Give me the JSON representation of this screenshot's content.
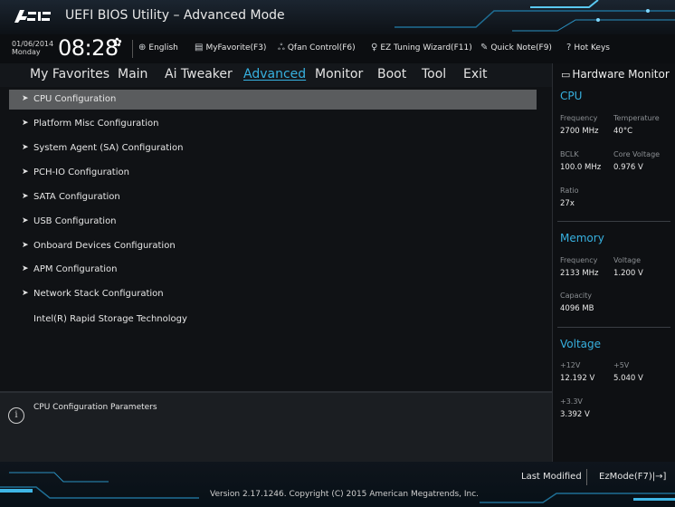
{
  "window": {
    "logo_text": "ASUS",
    "title": "UEFI BIOS Utility – Advanced Mode"
  },
  "infobar": {
    "date": "01/06/2014",
    "day": "Monday",
    "time": "08:28",
    "settings_icon": "gear-icon",
    "tools": [
      {
        "icon": "globe-icon",
        "label": "English"
      },
      {
        "icon": "favorite-icon",
        "label": "MyFavorite(F3)"
      },
      {
        "icon": "fan-icon",
        "label": "Qfan Control(F6)"
      },
      {
        "icon": "bulb-icon",
        "label": "EZ Tuning Wizard(F11)"
      },
      {
        "icon": "note-icon",
        "label": "Quick Note(F9)"
      },
      {
        "icon": "help-icon",
        "label": "Hot Keys"
      }
    ]
  },
  "tabs": [
    {
      "label": "My Favorites",
      "active": false
    },
    {
      "label": "Main",
      "active": false
    },
    {
      "label": "Ai Tweaker",
      "active": false
    },
    {
      "label": "Advanced",
      "active": true
    },
    {
      "label": "Monitor",
      "active": false
    },
    {
      "label": "Boot",
      "active": false
    },
    {
      "label": "Tool",
      "active": false
    },
    {
      "label": "Exit",
      "active": false
    }
  ],
  "menu": {
    "arrow_glyph": "➤",
    "items": [
      {
        "label": "CPU Configuration",
        "selected": true,
        "submenu": true
      },
      {
        "label": "Platform Misc Configuration",
        "selected": false,
        "submenu": true
      },
      {
        "label": "System Agent (SA) Configuration",
        "selected": false,
        "submenu": true
      },
      {
        "label": "PCH-IO Configuration",
        "selected": false,
        "submenu": true
      },
      {
        "label": "SATA Configuration",
        "selected": false,
        "submenu": true
      },
      {
        "label": "USB Configuration",
        "selected": false,
        "submenu": true
      },
      {
        "label": "Onboard Devices Configuration",
        "selected": false,
        "submenu": true
      },
      {
        "label": "APM Configuration",
        "selected": false,
        "submenu": true
      },
      {
        "label": "Network Stack Configuration",
        "selected": false,
        "submenu": true
      },
      {
        "label": "Intel(R) Rapid Storage Technology",
        "selected": false,
        "submenu": false
      }
    ]
  },
  "description": {
    "icon": "info-icon",
    "text": "CPU Configuration Parameters"
  },
  "hardware_monitor": {
    "title": "Hardware Monitor",
    "title_icon": "monitor-icon",
    "cpu": {
      "heading": "CPU",
      "frequency_label": "Frequency",
      "frequency": "2700 MHz",
      "temperature_label": "Temperature",
      "temperature": "40°C",
      "bclk_label": "BCLK",
      "bclk": "100.0 MHz",
      "core_voltage_label": "Core Voltage",
      "core_voltage": "0.976 V",
      "ratio_label": "Ratio",
      "ratio": "27x"
    },
    "memory": {
      "heading": "Memory",
      "frequency_label": "Frequency",
      "frequency": "2133 MHz",
      "voltage_label": "Voltage",
      "voltage": "1.200 V",
      "capacity_label": "Capacity",
      "capacity": "4096 MB"
    },
    "voltage": {
      "heading": "Voltage",
      "v12_label": "+12V",
      "v12": "12.192 V",
      "v5_label": "+5V",
      "v5": "5.040 V",
      "v33_label": "+3.3V",
      "v33": "3.392 V"
    }
  },
  "footer": {
    "last_modified": "Last Modified",
    "ezmode": "EzMode(F7)|→]",
    "version": "Version 2.17.1246. Copyright (C) 2015 American Megatrends, Inc."
  },
  "colors": {
    "accent": "#37b1e0",
    "selected_row": "#5a5c5e",
    "background": "#101215"
  }
}
